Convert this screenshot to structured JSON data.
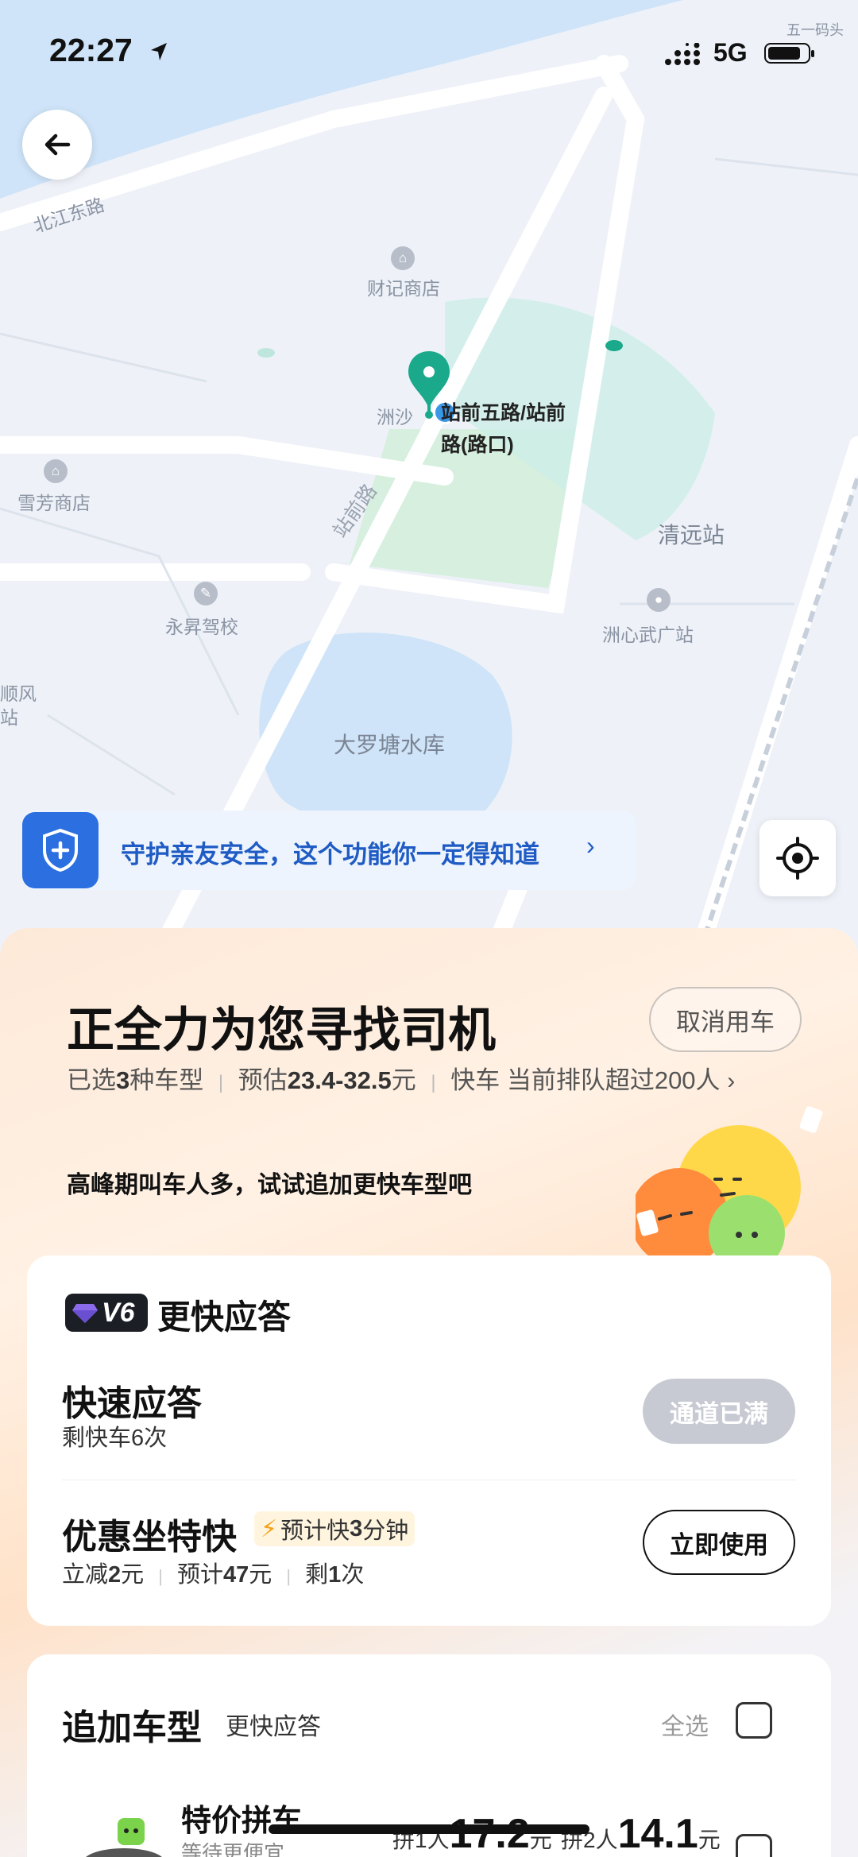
{
  "status_bar": {
    "time": "22:27",
    "network": "5G"
  },
  "map": {
    "labels": {
      "beijiang_road": "北江东路",
      "caiji_store": "财记商店",
      "xuefang_store": "雪芳商店",
      "yongsheng_school": "永昇驾校",
      "zhanqian_road": "站前路",
      "qingyuan_station": "清远站",
      "zhouxin_square": "洲心武广站",
      "daluotang": "大罗塘水库",
      "wuyi_pier": "五一码头",
      "zhousha": "洲沙",
      "left_partial_1": "顺风",
      "left_partial_2": "站"
    },
    "pickup_label": [
      "站前五路/站前",
      "路(路口)"
    ],
    "safety_banner": "守护亲友安全，这个功能你一定得知道",
    "colors": {
      "pin": "#1aa98a",
      "water": "#cfe4f8",
      "park": "#d6efdf"
    }
  },
  "sheet": {
    "title": "正全力为您寻找司机",
    "cancel_label": "取消用车",
    "sub": {
      "selected_prefix": "已选",
      "selected_count": "3",
      "selected_suffix": "种车型",
      "estimate_prefix": "预估",
      "estimate_range": "23.4-32.5",
      "estimate_unit": "元",
      "queue_text": "快车 当前排队超过200人"
    },
    "tip": "高峰期叫车人多，试试追加更快车型吧"
  },
  "v6_card": {
    "badge": "V6",
    "heading": "更快应答",
    "fast_response": {
      "title": "快速应答",
      "sub": "剩快车6次",
      "button": "通道已满"
    },
    "discount_express": {
      "title": "优惠坐特快",
      "tag_prefix": "预计快",
      "tag_value": "3",
      "tag_suffix": "分钟",
      "sub_parts": [
        {
          "pre": "立减",
          "val": "2",
          "post": "元"
        },
        {
          "pre": "预计",
          "val": "47",
          "post": "元"
        },
        {
          "pre": "剩",
          "val": "1",
          "post": "次"
        }
      ],
      "button": "立即使用"
    }
  },
  "extra_card": {
    "heading": "追加车型",
    "heading_sub": "更快应答",
    "select_all": "全选",
    "car": {
      "title": "特价拼车",
      "sub": "等待更便宜",
      "price_1_prefix": "拼1人",
      "price_1": "17.2",
      "price_1_unit": "元",
      "price_2_prefix": "拼2人",
      "price_2": "14.1",
      "price_2_unit": "元"
    }
  }
}
